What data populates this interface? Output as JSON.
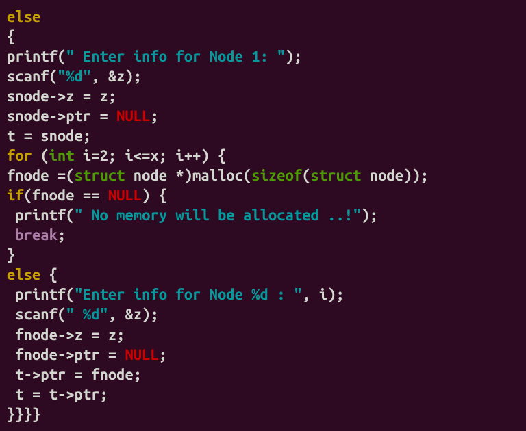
{
  "code": {
    "l1_else": "else",
    "l2_brace": "{",
    "l3_a": "printf(",
    "l3_str": "\" Enter info for Node 1: \"",
    "l3_b": ");",
    "l4_a": "scanf(",
    "l4_str": "\"%d\"",
    "l4_b": ", &z);",
    "l5": "snode->z = z;",
    "l6_a": "snode->ptr = ",
    "l6_null": "NULL",
    "l6_b": ";",
    "l7": "t = snode;",
    "l8_for": "for",
    "l8_a": " (",
    "l8_int": "int",
    "l8_b": " i=2; i<=x; i++) {",
    "l9_a": "fnode =(",
    "l9_struct1": "struct",
    "l9_b": " node *)malloc(",
    "l9_sizeof": "sizeof",
    "l9_c": "(",
    "l9_struct2": "struct",
    "l9_d": " node));",
    "l10_if": "if",
    "l10_a": "(fnode == ",
    "l10_null": "NULL",
    "l10_b": ") {",
    "l11_a": " printf(",
    "l11_str": "\" No memory will be allocated ..!\"",
    "l11_b": ");",
    "l12_sp": " ",
    "l12_break": "break",
    "l12_b": ";",
    "l13": "}",
    "l14_else": "else",
    "l14_b": " {",
    "l15_a": " printf(",
    "l15_str": "\"Enter info for Node %d : \"",
    "l15_b": ", i);",
    "l16_a": " scanf(",
    "l16_str": "\" %d\"",
    "l16_b": ", &z);",
    "l17": " fnode->z = z;",
    "l18_a": " fnode->ptr = ",
    "l18_null": "NULL",
    "l18_b": ";",
    "l19": " t->ptr = fnode;",
    "l20": " t = t->ptr;",
    "l21": "}}}}"
  }
}
